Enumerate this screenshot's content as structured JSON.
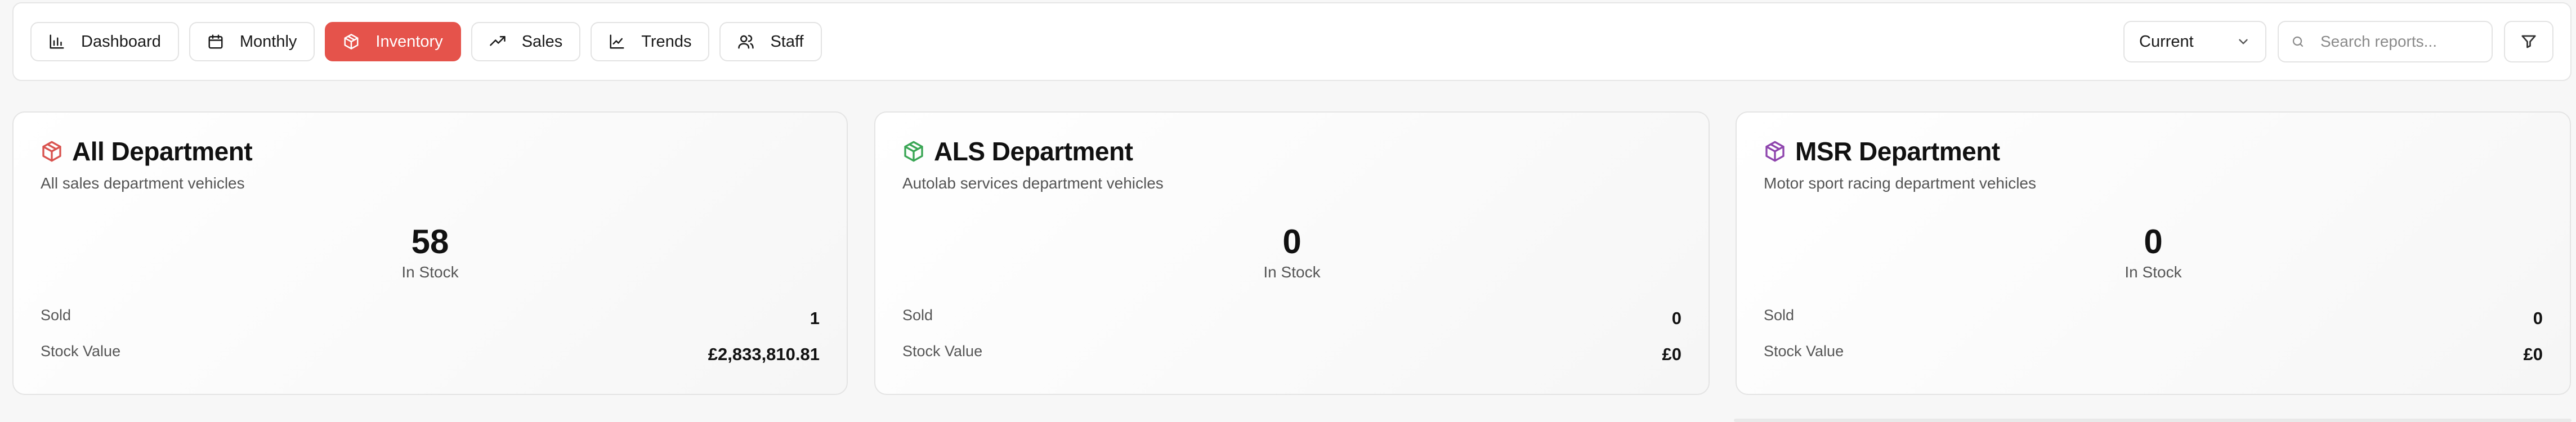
{
  "toolbar": {
    "tabs": [
      {
        "label": "Dashboard",
        "icon": "bar-chart-icon",
        "active": false
      },
      {
        "label": "Monthly",
        "icon": "calendar-icon",
        "active": false
      },
      {
        "label": "Inventory",
        "icon": "box-icon",
        "active": true
      },
      {
        "label": "Sales",
        "icon": "trending-up-icon",
        "active": false
      },
      {
        "label": "Trends",
        "icon": "line-chart-icon",
        "active": false
      },
      {
        "label": "Staff",
        "icon": "users-icon",
        "active": false
      }
    ],
    "period_select": {
      "value": "Current"
    },
    "search": {
      "placeholder": "Search reports..."
    }
  },
  "colors": {
    "accent": "#e5534b",
    "all_icon": "#d9534f",
    "als_icon": "#3aa655",
    "msr_icon": "#8e44ad"
  },
  "cards": [
    {
      "title": "All Department",
      "subtitle": "All sales department vehicles",
      "stock": "58",
      "stock_label": "In Stock",
      "sold_label": "Sold",
      "sold": "1",
      "value_label": "Stock Value",
      "value": "£2,833,810.81"
    },
    {
      "title": "ALS Department",
      "subtitle": "Autolab services department vehicles",
      "stock": "0",
      "stock_label": "In Stock",
      "sold_label": "Sold",
      "sold": "0",
      "value_label": "Stock Value",
      "value": "£0"
    },
    {
      "title": "MSR Department",
      "subtitle": "Motor sport racing department vehicles",
      "stock": "0",
      "stock_label": "In Stock",
      "sold_label": "Sold",
      "sold": "0",
      "value_label": "Stock Value",
      "value": "£0"
    }
  ]
}
